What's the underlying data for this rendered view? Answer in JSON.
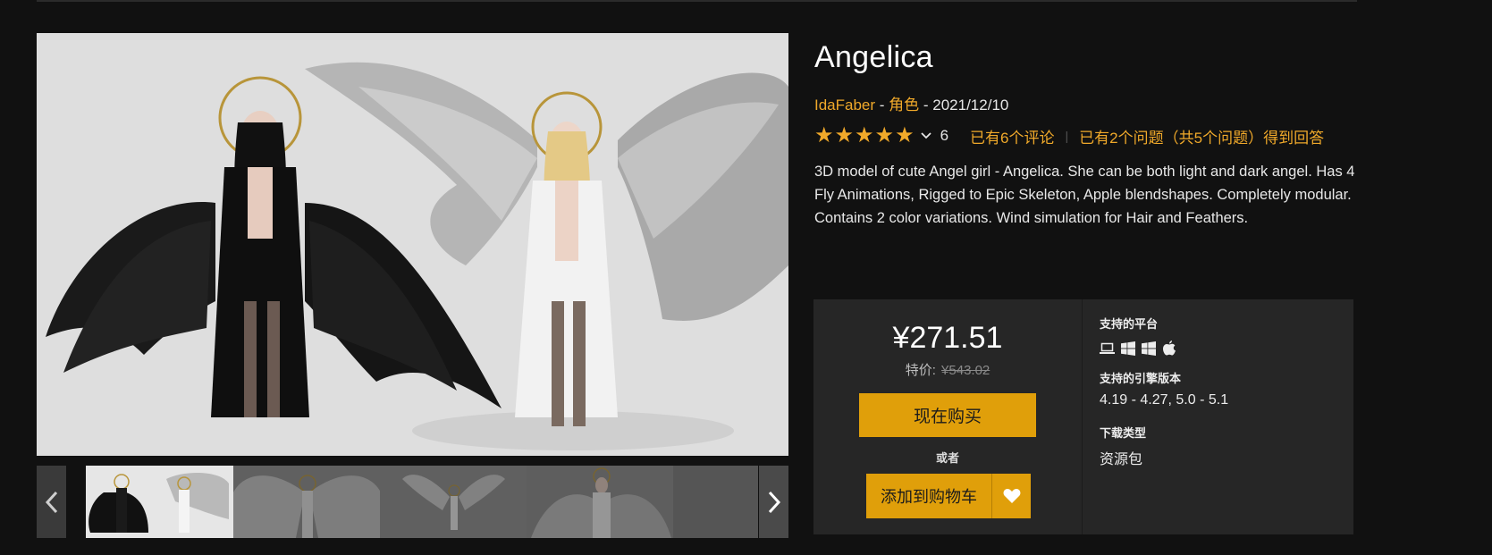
{
  "product": {
    "title": "Angelica",
    "seller": "IdaFaber",
    "dash1": " - ",
    "category": "角色",
    "dash2": " - ",
    "date": "2021/12/10",
    "rating_stars": 5,
    "rating_count": "6",
    "reviews_link": "已有6个评论",
    "divider": "|",
    "qa_link": "已有2个问题（共5个问题）得到回答",
    "description": "3D model of cute Angel girl - Angelica. She can be both light and dark angel. Has 4 Fly Animations, Rigged to Epic Skeleton, Apple blendshapes. Completely modular. Contains 2 color variations. Wind simulation for Hair and Feathers."
  },
  "purchase": {
    "price": "¥271.51",
    "sale_label": "特价:",
    "original_price": "¥543.02",
    "buy_now_label": "现在购买",
    "or_label": "或者",
    "add_to_cart_label": "添加到购物车"
  },
  "specs": {
    "platforms_heading": "支持的平台",
    "platform_icons": [
      "laptop-icon",
      "windows-icon",
      "windows-icon",
      "apple-icon"
    ],
    "engine_heading": "支持的引擎版本",
    "engine_versions": "4.19 - 4.27, 5.0 - 5.1",
    "download_heading": "下载类型",
    "download_type": "资源包"
  },
  "gallery": {
    "thumbnail_count": 5,
    "active_thumbnail": 1
  },
  "colors": {
    "background": "#111111",
    "accent": "#f0a92a",
    "button": "#e09f0a",
    "panel": "#262626"
  }
}
